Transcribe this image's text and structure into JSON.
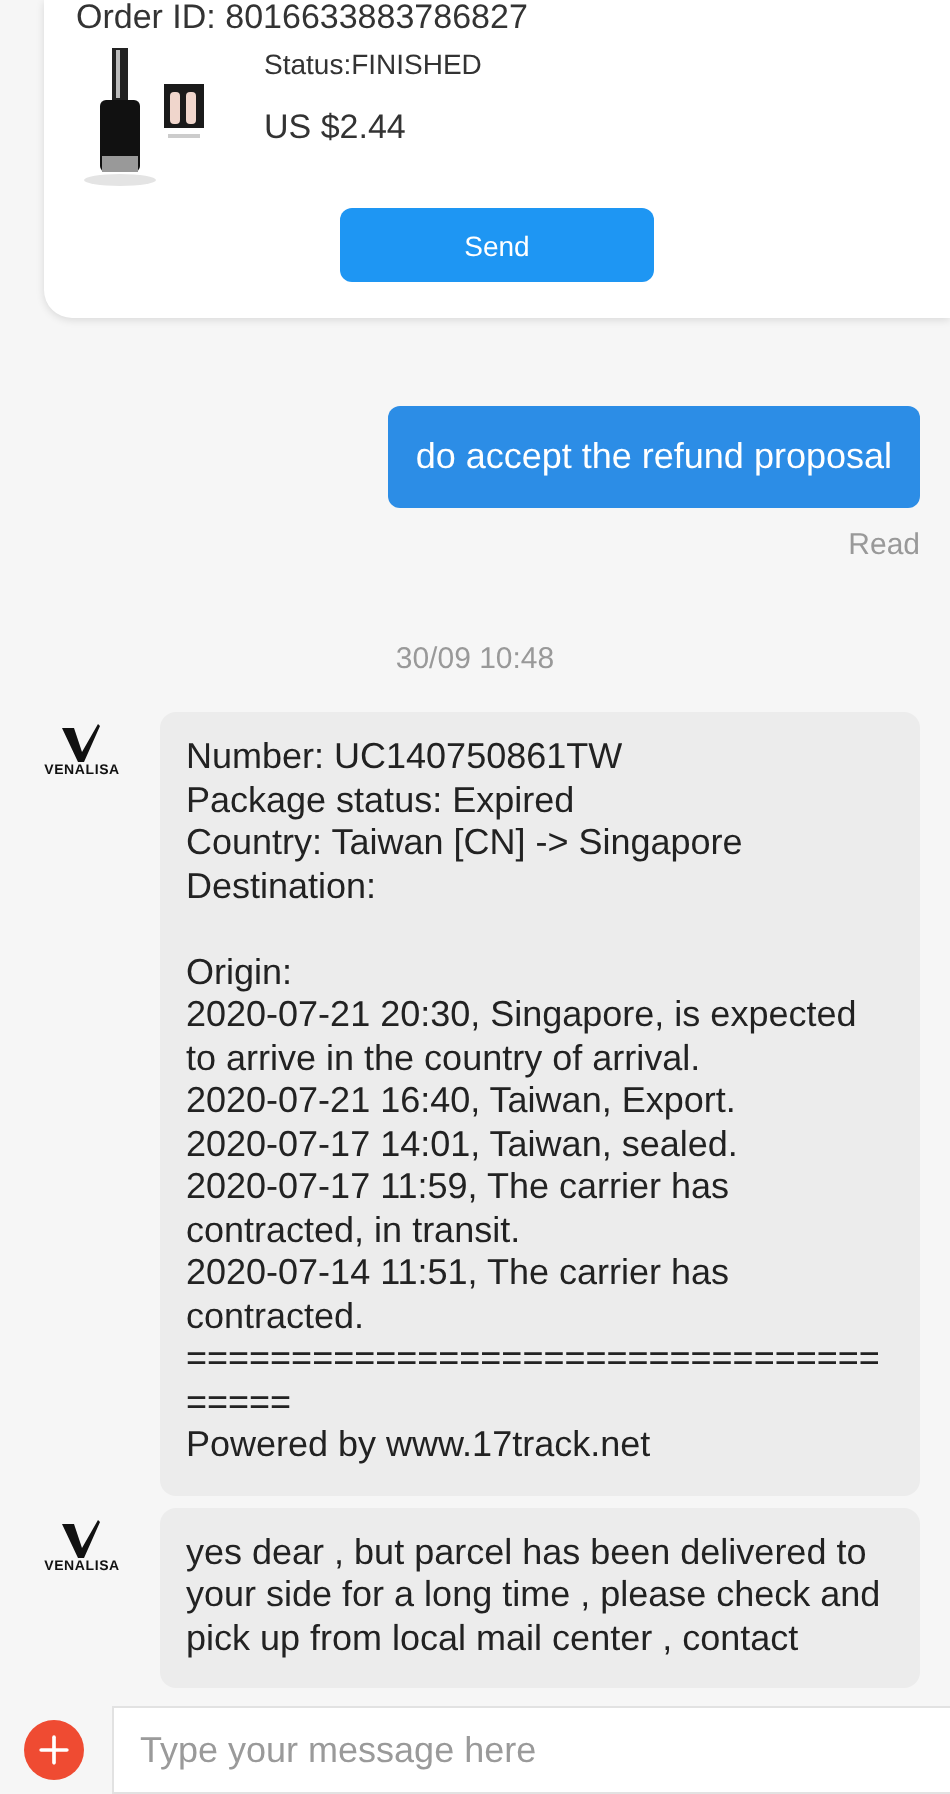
{
  "order_card": {
    "order_id": "Order ID: 8016633883786827",
    "status": "Status:FINISHED",
    "price": "US $2.44",
    "send_button": "Send"
  },
  "messages": [
    {
      "kind": "outgoing",
      "text": "do accept the refund proposal",
      "receipt": "Read"
    },
    {
      "kind": "timestamp",
      "text": "30/09 10:48"
    },
    {
      "kind": "incoming",
      "sender_logo": "VENALISA",
      "paragraphs": [
        [
          "Number: UC140750861TW",
          "Package status: Expired",
          "Country: Taiwan [CN] -> Singapore",
          "Destination:"
        ],
        [
          "Origin:",
          "2020-07-21 20:30, Singapore, is expected to arrive in the country of arrival.",
          "2020-07-21 16:40, Taiwan, Export.",
          "2020-07-17 14:01, Taiwan, sealed.",
          "2020-07-17 11:59, The carrier has contracted, in transit.",
          "2020-07-14 11:51, The carrier has contracted.",
          "======================================",
          "Powered by www.17track.net"
        ]
      ]
    },
    {
      "kind": "incoming",
      "sender_logo": "VENALISA",
      "paragraphs": [
        [
          "yes dear  , but parcel has been delivered to your side for a long time , please check and pick up from local mail center , contact"
        ]
      ]
    }
  ],
  "composer": {
    "placeholder": "Type your message here"
  }
}
